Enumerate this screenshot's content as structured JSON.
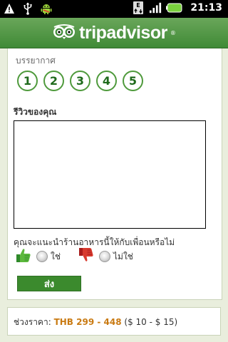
{
  "status_bar": {
    "time": "21:13",
    "icons": [
      "warning-icon",
      "usb-icon",
      "android-icon",
      "data-transfer-icon",
      "signal-icon",
      "battery-icon"
    ]
  },
  "header": {
    "logo_text": "tripadvisor",
    "logo_reg": "®",
    "colors": {
      "bar": "#4f9a3c",
      "text": "#ffffff"
    }
  },
  "form": {
    "atmosphere_label": "บรรยากาศ",
    "rating_options": [
      "1",
      "2",
      "3",
      "4",
      "5"
    ],
    "review_label": "รีวิวของคุณ",
    "review_value": "",
    "recommend_question": "คุณจะแนะนำร้านอาหารนี้ให้กับเพื่อนหรือไม่",
    "yes_label": "ใช่",
    "no_label": "ไม่ใช่",
    "submit_label": "ส่ง"
  },
  "price": {
    "label": "ช่วงราคา:",
    "thb_range": "THB 299 - 448",
    "usd_range": "($ 10 - $ 15)"
  },
  "colors": {
    "accent_green": "#3b8a2d",
    "price_orange": "#c97a12",
    "background": "#e9eedd"
  }
}
